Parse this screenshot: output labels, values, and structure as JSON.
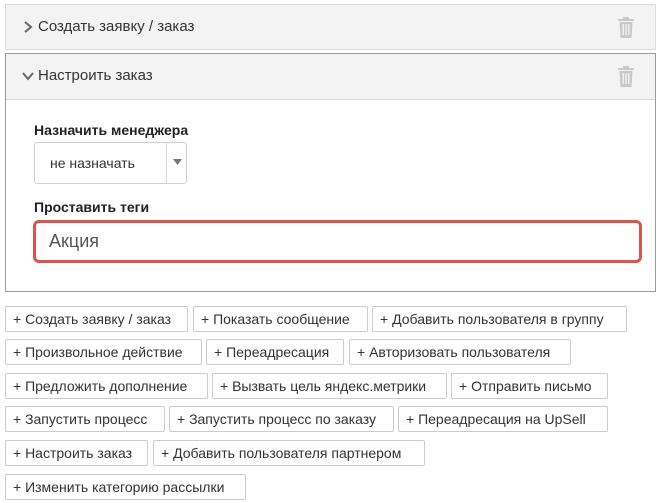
{
  "panels": {
    "create": {
      "title": "Создать заявку / заказ"
    },
    "configure": {
      "title": "Настроить заказ",
      "manager_label": "Назначить менеджера",
      "manager_value": "не назначать",
      "tags_label": "Проставить теги",
      "tags_value": "Акция"
    }
  },
  "actions": [
    "+ Создать заявку / заказ",
    "+ Показать сообщение",
    "+ Добавить пользователя в группу",
    "+ Произвольное действие",
    "+ Переадресация",
    "+ Авторизовать пользователя",
    "+ Предложить дополнение",
    "+ Вызвать цель яндекс.метрики",
    "+ Отправить письмо",
    "+ Запустить процесс",
    "+ Запустить процесс по заказу",
    "+ Переадресация на UpSell",
    "+ Настроить заказ",
    "+ Добавить пользователя партнером",
    "+ Изменить категорию рассылки"
  ],
  "colors": {
    "highlight_border": "#d9534f",
    "panel_bg": "#f3f3f3",
    "icon_gray": "#c8c8c8"
  },
  "icons": {
    "collapsed": "chevron-right-icon",
    "expanded": "chevron-down-icon",
    "delete": "trash-icon",
    "select": "caret-down-icon"
  }
}
